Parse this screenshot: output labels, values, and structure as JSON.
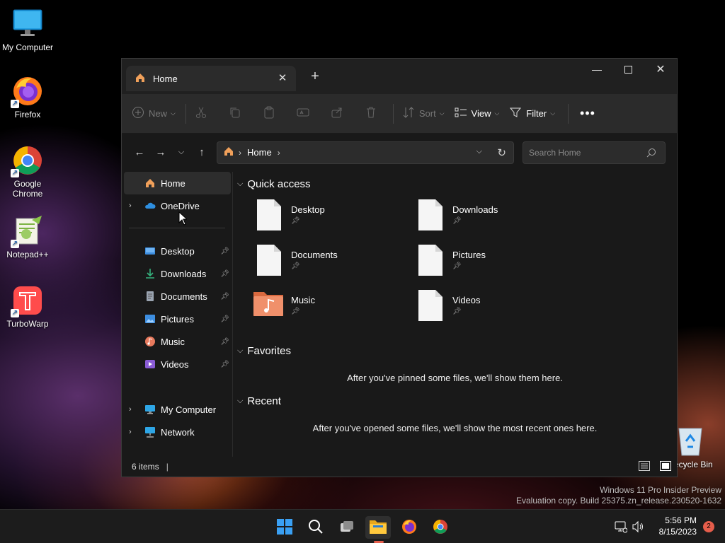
{
  "desktop": {
    "icons": [
      {
        "label": "My Computer",
        "icon": "monitor-icon"
      },
      {
        "label": "Firefox",
        "icon": "firefox-icon"
      },
      {
        "label": "Google Chrome",
        "icon": "chrome-icon"
      },
      {
        "label": "Notepad++",
        "icon": "notepadpp-icon"
      },
      {
        "label": "TurboWarp",
        "icon": "turbowarp-icon"
      },
      {
        "label": "Recycle Bin",
        "icon": "recycle-bin-icon"
      }
    ]
  },
  "window": {
    "tab_title": "Home",
    "toolbar": {
      "new_label": "New",
      "sort_label": "Sort",
      "view_label": "View",
      "filter_label": "Filter"
    },
    "address": {
      "crumb": "Home"
    },
    "search": {
      "placeholder": "Search Home"
    },
    "nav": {
      "home": "Home",
      "onedrive": "OneDrive",
      "pinned": [
        {
          "label": "Desktop",
          "icon": "desktop-folder-icon",
          "color": "#3d8ee0"
        },
        {
          "label": "Downloads",
          "icon": "downloads-folder-icon",
          "color": "#36b37e"
        },
        {
          "label": "Documents",
          "icon": "documents-folder-icon",
          "color": "#9aa4b1"
        },
        {
          "label": "Pictures",
          "icon": "pictures-folder-icon",
          "color": "#3d8ee0"
        },
        {
          "label": "Music",
          "icon": "music-folder-icon",
          "color": "#e87a5d"
        },
        {
          "label": "Videos",
          "icon": "videos-folder-icon",
          "color": "#8a5cd6"
        }
      ],
      "my_computer": "My Computer",
      "network": "Network"
    },
    "content": {
      "quick_access_title": "Quick access",
      "quick_access": [
        {
          "name": "Desktop"
        },
        {
          "name": "Downloads"
        },
        {
          "name": "Documents"
        },
        {
          "name": "Pictures"
        },
        {
          "name": "Music"
        },
        {
          "name": "Videos"
        }
      ],
      "favorites_title": "Favorites",
      "favorites_empty": "After you've pinned some files, we'll show them here.",
      "recent_title": "Recent",
      "recent_empty": "After you've opened some files, we'll show the most recent ones here."
    },
    "status": {
      "items": "6 items"
    }
  },
  "watermark": {
    "line1": "Windows 11 Pro Insider Preview",
    "line2": "Evaluation copy. Build 25375.zn_release.230520-1632"
  },
  "taskbar": {
    "time": "5:56 PM",
    "date": "8/15/2023",
    "notifications": "2"
  },
  "colors": {
    "accent": "#e55d4b",
    "window_bg": "#191919",
    "toolbar_bg": "#2b2b2b"
  }
}
